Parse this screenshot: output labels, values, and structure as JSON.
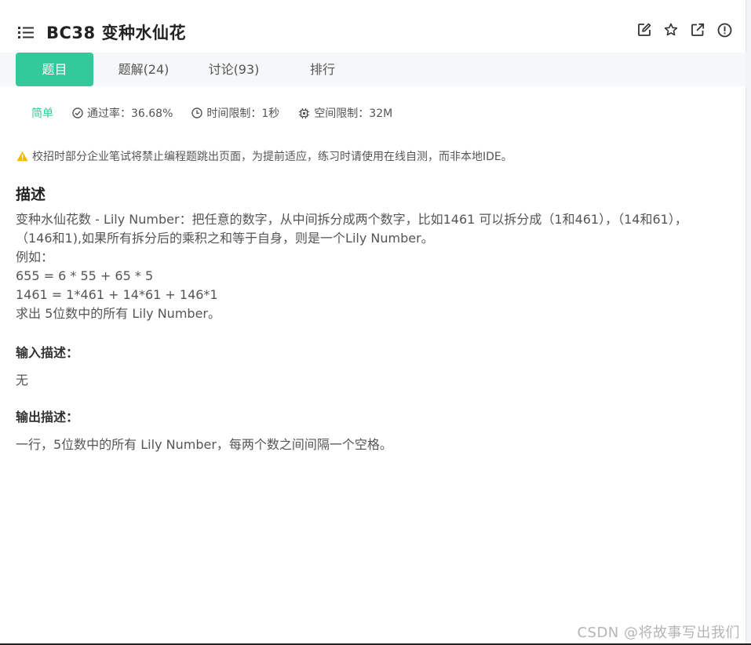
{
  "header": {
    "title": "BC38  变种水仙花"
  },
  "tabs": [
    {
      "label": "题目",
      "active": true
    },
    {
      "label": "题解(24)",
      "active": false
    },
    {
      "label": "讨论(93)",
      "active": false
    },
    {
      "label": "排行",
      "active": false
    }
  ],
  "meta": {
    "difficulty": "简单",
    "pass_rate": "通过率：36.68%",
    "time_limit": "时间限制：1秒",
    "space_limit": "空间限制：32M"
  },
  "notice": "校招时部分企业笔试将禁止编程题跳出页面，为提前适应，练习时请使用在线自测，而非本地IDE。",
  "description": {
    "heading": "描述",
    "lines": [
      "变种水仙花数 - Lily Number：把任意的数字，从中间拆分成两个数字，比如1461 可以拆分成（1和461），（14和61），",
      "（146和1),如果所有拆分后的乘积之和等于自身，则是一个Lily Number。",
      "例如：",
      "655 = 6 * 55 + 65 * 5",
      "1461 = 1*461 + 14*61 + 146*1",
      "求出 5位数中的所有 Lily Number。"
    ]
  },
  "input": {
    "heading": "输入描述：",
    "text": "无"
  },
  "output": {
    "heading": "输出描述：",
    "text": "一行，5位数中的所有 Lily Number，每两个数之间间隔一个空格。"
  },
  "watermark": "CSDN @将故事写出我们",
  "colors": {
    "accent": "#32ca99",
    "warning": "#f5b800"
  }
}
